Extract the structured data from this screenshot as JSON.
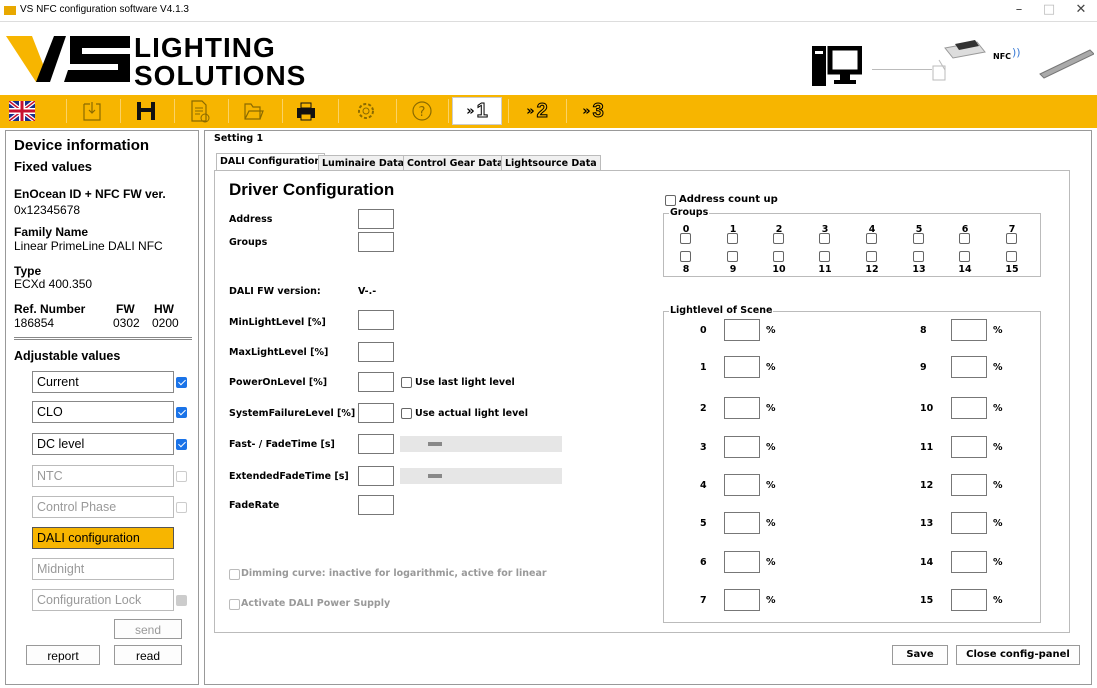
{
  "window": {
    "title": "VS NFC configuration software V4.1.3",
    "minimize": "–",
    "maximize": "□",
    "close": "✕"
  },
  "logo": {
    "line1": "LIGHTING",
    "line2": "SOLUTIONS",
    "nfc_label": "NFC"
  },
  "toolbar": {
    "items": [
      "language-flag-uk",
      "import",
      "save",
      "export-pdf",
      "open-file",
      "print",
      "settings",
      "help",
      "nfc-1",
      "nfc-2",
      "nfc-3"
    ],
    "nfc1": "1",
    "nfc2": "2",
    "nfc3": "3"
  },
  "left": {
    "device_information": "Device information",
    "fixed_values": "Fixed values",
    "enocean_label": "EnOcean ID + NFC FW ver.",
    "enocean_value": "0x12345678",
    "family_label": "Family Name",
    "family_value": "Linear PrimeLine DALI NFC",
    "type_label": "Type",
    "type_value": "ECXd 400.350",
    "ref_label": "Ref. Number",
    "ref_value": "186854",
    "fw_label": "FW",
    "fw_value": "0302",
    "hw_label": "HW",
    "hw_value": "0200",
    "adjustable_values": "Adjustable values",
    "items": [
      {
        "label": "Current",
        "checked": true
      },
      {
        "label": "CLO",
        "checked": true
      },
      {
        "label": "DC level",
        "checked": true
      },
      {
        "label": "NTC",
        "checked": false
      },
      {
        "label": "Control Phase",
        "checked": false
      },
      {
        "label": "DALI configuration",
        "checked": false
      },
      {
        "label": "Midnight",
        "checked": false
      },
      {
        "label": "Configuration Lock",
        "checked": true
      }
    ],
    "send": "send",
    "report": "report",
    "read": "read"
  },
  "main": {
    "setting": "Setting 1",
    "tabs": [
      "DALI Configuration",
      "Luminaire Data",
      "Control Gear Data",
      "Lightsource Data"
    ],
    "driver_configuration": "Driver Configuration",
    "address": "Address",
    "groups": "Groups",
    "dali_fw_label": "DALI FW version:",
    "dali_fw_value": "V-.-",
    "min_light": "MinLightLevel [%]",
    "max_light": "MaxLightLevel [%]",
    "power_on": "PowerOnLevel [%]",
    "use_last": "Use last light level",
    "sys_fail": "SystemFailureLevel [%]",
    "use_actual": "Use actual light level",
    "fade_time": "Fast- / FadeTime [s]",
    "ext_fade": "ExtendedFadeTime  [s]",
    "fade_rate": "FadeRate",
    "dimming_curve": "Dimming curve: inactive for logarithmic, active for linear",
    "activate_psu": "Activate DALI Power Supply",
    "address_count_up": "Address count up",
    "groups_title": "Groups",
    "group_numbers": [
      "0",
      "1",
      "2",
      "3",
      "4",
      "5",
      "6",
      "7",
      "8",
      "9",
      "10",
      "11",
      "12",
      "13",
      "14",
      "15"
    ],
    "scene_title": "Lightlevel of Scene",
    "scenes": [
      "0",
      "1",
      "2",
      "3",
      "4",
      "5",
      "6",
      "7",
      "8",
      "9",
      "10",
      "11",
      "12",
      "13",
      "14",
      "15"
    ],
    "pct": "%",
    "save": "Save",
    "close_panel": "Close config-panel"
  }
}
